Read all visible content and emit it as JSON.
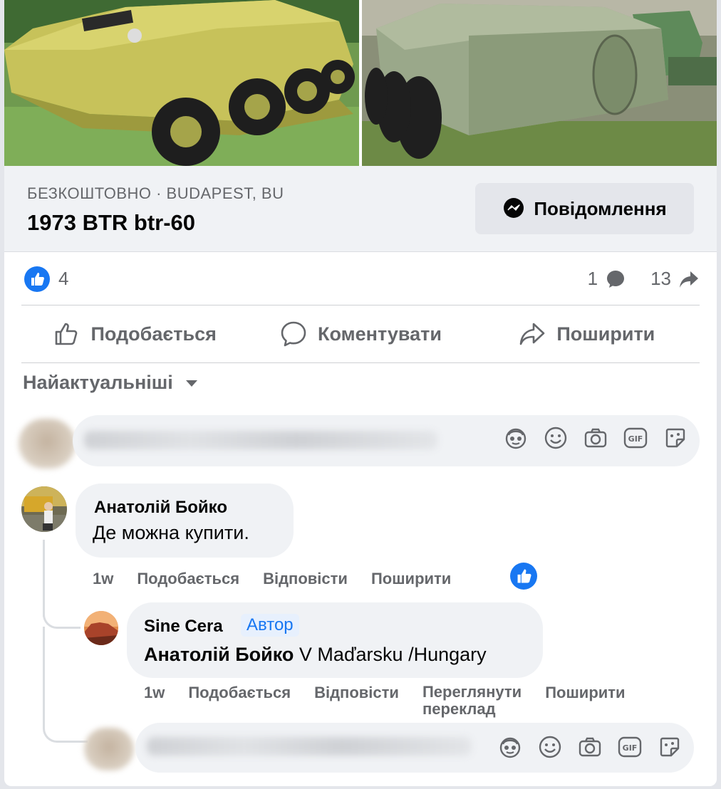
{
  "listing": {
    "meta": "БЕЗКОШТОВНО · BUDAPEST, BU",
    "title": "1973 BTR btr-60",
    "message_button": "Повідомлення"
  },
  "stats": {
    "likes": "4",
    "comments": "1",
    "shares": "13"
  },
  "actions": {
    "like": "Подобається",
    "comment": "Коментувати",
    "share": "Поширити"
  },
  "sort_label": "Найактуальніші",
  "composer_tools": [
    "avatar-sticker-icon",
    "emoji-icon",
    "camera-icon",
    "gif-icon",
    "sticker-icon"
  ],
  "comments": [
    {
      "author": "Анатолій Бойко",
      "text": "Де можна купити.",
      "time": "1w",
      "like": "Подобається",
      "reply": "Відповісти",
      "share": "Поширити"
    }
  ],
  "reply": {
    "author": "Sine Cera",
    "badge": "Автор",
    "mention": "Анатолій Бойко",
    "text": " V Maďarsku /Hungary",
    "time": "1w",
    "like": "Подобається",
    "reply": "Відповісти",
    "translate_line1": "Переглянути",
    "translate_line2": "переклад",
    "share": "Поширити"
  },
  "colors": {
    "accent": "#1877f2",
    "secondary_text": "#65676b",
    "bubble": "#f0f2f5"
  }
}
